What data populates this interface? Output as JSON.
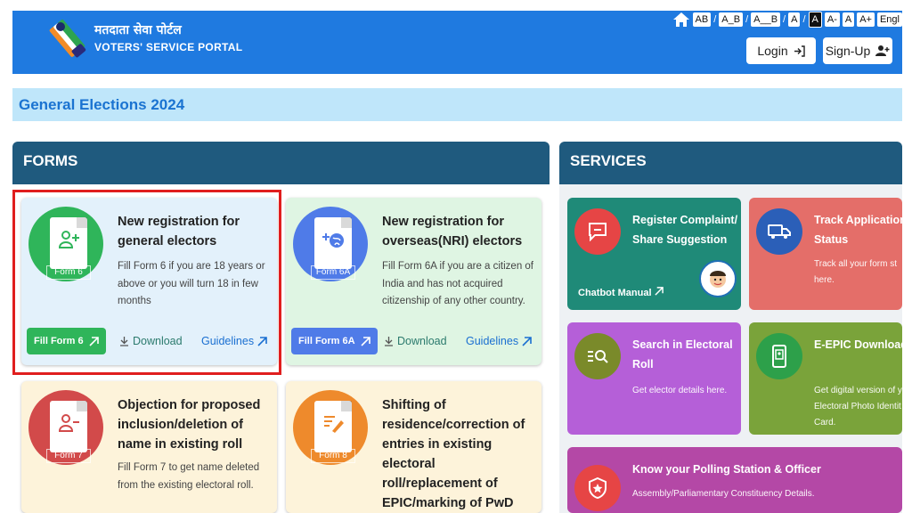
{
  "header": {
    "logo_hindi": "मतदाता सेवा पोर्टल",
    "logo_english": "VOTERS' SERVICE PORTAL",
    "font_controls": [
      "AB",
      "A_B",
      "A__B",
      "A",
      "A",
      "A-",
      "A",
      "A+"
    ],
    "language": "Engl",
    "login_label": "Login",
    "signup_label": "Sign-Up"
  },
  "banner": {
    "text": "General Elections 2024"
  },
  "forms": {
    "heading": "FORMS",
    "cards": [
      {
        "form_label": "Form 6",
        "title": "New registration for general electors",
        "description": "Fill Form 6 if you are 18 years or above or you will turn 18 in few months",
        "fill_label": "Fill Form 6",
        "download_label": "Download",
        "guidelines_label": "Guidelines",
        "color": "#2fb55a"
      },
      {
        "form_label": "Form 6A",
        "title": "New registration for overseas(NRI) electors",
        "description": "Fill Form 6A if you are a citizen of India and has not acquired citizenship of any other country.",
        "fill_label": "Fill Form 6A",
        "download_label": "Download",
        "guidelines_label": "Guidelines",
        "color": "#4f7be8"
      },
      {
        "form_label": "Form 7",
        "title": "Objection for proposed inclusion/deletion of name in existing roll",
        "description": "Fill Form 7 to get name deleted from the existing electoral roll.",
        "color": "#d24a4a"
      },
      {
        "form_label": "Form 8",
        "title": "Shifting of residence/correction of entries in existing electoral roll/replacement of EPIC/marking of PwD",
        "description": "",
        "color": "#ee8a2c"
      }
    ]
  },
  "services": {
    "heading": "SERVICES",
    "cards": [
      {
        "title": "Register Complaint/ Share Suggestion",
        "description": "",
        "extra": "Chatbot Manual"
      },
      {
        "title": "Track Application Status",
        "description": "Track all your form st here."
      },
      {
        "title": "Search in Electoral Roll",
        "description": "Get elector details here."
      },
      {
        "title": "E-EPIC Download",
        "description": "Get digital version of y Electoral Photo Identit Card."
      },
      {
        "title": "Know your Polling Station & Officer",
        "description": "Assembly/Parliamentary Constituency Details."
      }
    ]
  },
  "colors": {
    "header": "#1f7ae0",
    "panel_head": "#1f5a7e",
    "highlight": "#e01e1e"
  }
}
